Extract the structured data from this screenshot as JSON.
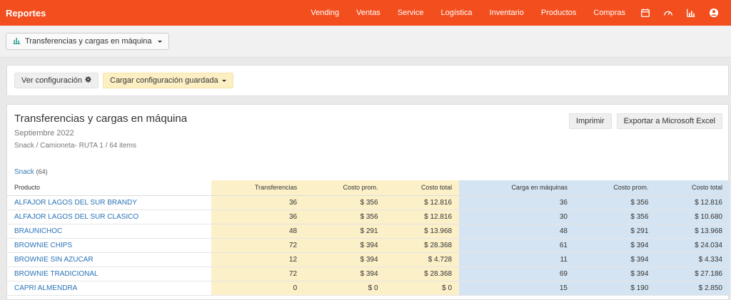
{
  "app": {
    "title": "Reportes"
  },
  "nav": {
    "items": [
      "Vending",
      "Ventas",
      "Service",
      "Logística",
      "Inventario",
      "Productos",
      "Compras"
    ],
    "icons": [
      "calendar-icon",
      "speedometer-icon",
      "bar-chart-icon",
      "user-icon"
    ]
  },
  "report_selector": {
    "label": "Transferencias y cargas en máquina"
  },
  "config": {
    "view_label": "Ver configuración",
    "load_label": "Cargar configuración guardada"
  },
  "report": {
    "title": "Transferencias y cargas en máquina",
    "period": "Septiembre 2022",
    "subtitle": "Snack / Camioneta- RUTA 1 / 64 items",
    "print_label": "Imprimir",
    "export_label": "Exportar a Microsoft Excel",
    "group": {
      "name": "Snack",
      "count": "(64)"
    }
  },
  "table": {
    "columns": [
      "Producto",
      "Transferencias",
      "Costo prom.",
      "Costo total",
      "Carga en máquinas",
      "Costo prom.",
      "Costo total"
    ],
    "rows": [
      [
        "ALFAJOR LAGOS DEL SUR BRANDY",
        "36",
        "$ 356",
        "$ 12.816",
        "36",
        "$ 356",
        "$ 12.816"
      ],
      [
        "ALFAJOR LAGOS DEL SUR CLASICO",
        "36",
        "$ 356",
        "$ 12.816",
        "30",
        "$ 356",
        "$ 10.680"
      ],
      [
        "BRAUNICHOC",
        "48",
        "$ 291",
        "$ 13.968",
        "48",
        "$ 291",
        "$ 13.968"
      ],
      [
        "BROWNIE CHIPS",
        "72",
        "$ 394",
        "$ 28.368",
        "61",
        "$ 394",
        "$ 24.034"
      ],
      [
        "BROWNIE SIN AZUCAR",
        "12",
        "$ 394",
        "$ 4.728",
        "11",
        "$ 394",
        "$ 4.334"
      ],
      [
        "BROWNIE TRADICIONAL",
        "72",
        "$ 394",
        "$ 28.368",
        "69",
        "$ 394",
        "$ 27.186"
      ],
      [
        "CAPRI ALMENDRA",
        "0",
        "$ 0",
        "$ 0",
        "15",
        "$ 190",
        "$ 2.850"
      ]
    ]
  },
  "colors": {
    "topbar": "#f24e1e",
    "transfer_bg": "#fcf0c9",
    "load_bg": "#d5e4f2",
    "link": "#2a73b8"
  }
}
